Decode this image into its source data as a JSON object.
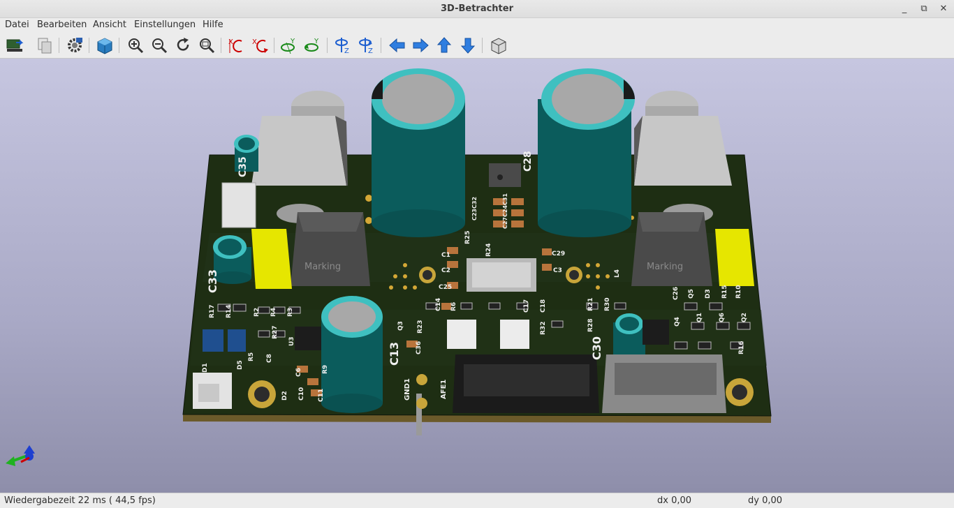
{
  "window": {
    "title": "3D-Betrachter",
    "minimize": "_",
    "restore": "⧉",
    "close": "✕"
  },
  "menu": [
    "Datei",
    "Bearbeiten",
    "Ansicht",
    "Einstellungen",
    "Hilfe"
  ],
  "toolbar": {
    "icons": [
      "reload-board-icon",
      "copy-image-icon",
      "settings-icon",
      "raytracing-icon",
      "zoom-in-icon",
      "zoom-out-icon",
      "redraw-icon",
      "zoom-fit-icon",
      "rotate-x-ccw-icon",
      "rotate-x-cw-icon",
      "rotate-y-ccw-icon",
      "rotate-y-cw-icon",
      "rotate-z-ccw-icon",
      "rotate-z-cw-icon",
      "pan-left-icon",
      "pan-right-icon",
      "pan-up-icon",
      "pan-down-icon",
      "ortho-projection-icon"
    ]
  },
  "board": {
    "labels": [
      "C35",
      "C33",
      "C28",
      "C13",
      "C30",
      "Marking",
      "Marking",
      "GND1",
      "AFE1",
      "C1",
      "C2",
      "C29",
      "C3",
      "C25",
      "R25",
      "R24",
      "L4",
      "R17",
      "R14",
      "R2",
      "R4",
      "R3",
      "R27",
      "R5",
      "C8",
      "U3",
      "D1",
      "D5",
      "D2",
      "C6",
      "C10",
      "C11",
      "R9",
      "Q3",
      "R23",
      "C36",
      "C14",
      "R6",
      "C17",
      "C18",
      "R21",
      "R30",
      "R32",
      "R28",
      "C26",
      "Q5",
      "D3",
      "R15",
      "R10",
      "Q4",
      "Q1",
      "Q6",
      "Q2",
      "R16",
      "C23C32",
      "C27C24C31"
    ]
  },
  "status": {
    "render_time": "Wiedergabezeit 22 ms ( 44,5 fps)",
    "dx": "dx 0,00",
    "dy": "dy 0,00"
  },
  "colors": {
    "board": "#1e2e13",
    "capacitor": "#0b5c5c",
    "capacitor_rim": "#3fc0c0",
    "connector": "#e6e600",
    "inductor": "#4a4a4a",
    "viewport_top": "#c6c6e0"
  }
}
